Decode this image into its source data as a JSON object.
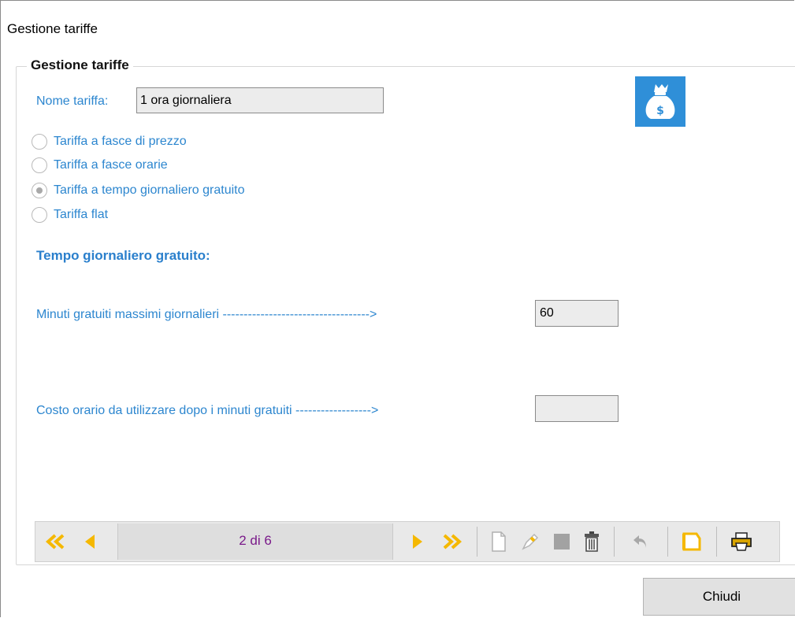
{
  "window": {
    "title": "Gestione tariffe"
  },
  "group": {
    "legend": "Gestione tariffe"
  },
  "name": {
    "label": "Nome tariffa:",
    "value": "1 ora giornaliera"
  },
  "tariff_types": [
    {
      "label": "Tariffa a fasce di prezzo",
      "checked": false
    },
    {
      "label": "Tariffa a fasce orarie",
      "checked": false
    },
    {
      "label": "Tariffa a tempo giornaliero gratuito",
      "checked": true
    },
    {
      "label": "Tariffa flat",
      "checked": false
    }
  ],
  "section": {
    "title": "Tempo giornaliero gratuito:"
  },
  "fields": {
    "max_minutes": {
      "label": "Minuti gratuiti massimi giornalieri ----------------------------------->",
      "value": "60"
    },
    "hourly_cost": {
      "label": "Costo orario da utilizzare dopo i minuti gratuiti ------------------>",
      "value": ""
    }
  },
  "navigator": {
    "position": "2 di 6",
    "icons": [
      "first-record-icon",
      "previous-record-icon",
      "next-record-icon",
      "last-record-icon",
      "new-record-icon",
      "edit-record-icon",
      "save-record-icon",
      "delete-record-icon",
      "undo-icon",
      "open-folder-icon",
      "print-icon"
    ]
  },
  "close_button": {
    "label": "Chiudi"
  },
  "colors": {
    "accent_blue": "#2c86cf",
    "nav_arrow": "#f5b800",
    "money_tile": "#2f8fd8",
    "position_text": "#7a1a8a"
  }
}
